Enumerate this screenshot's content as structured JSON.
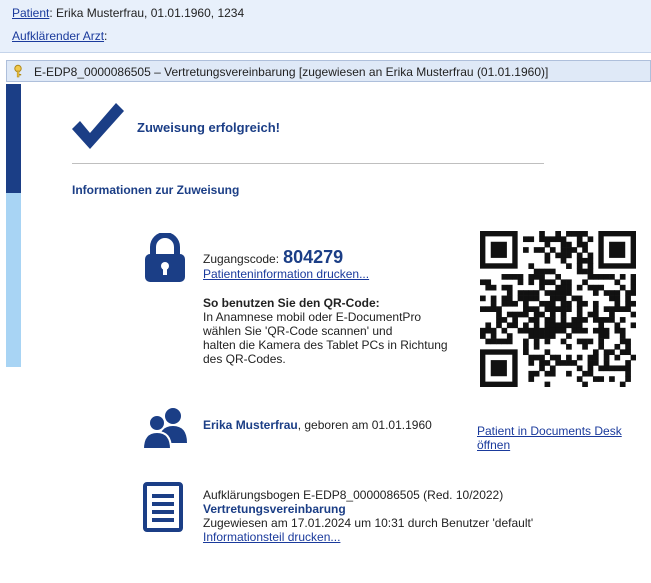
{
  "header": {
    "patient_label": "Patient",
    "patient_value": ": Erika Musterfrau, 01.01.1960, 1234",
    "doctor_label": "Aufklärender Arzt",
    "doctor_suffix": ":"
  },
  "document_bar": {
    "title": "E-EDP8_0000086505 – Vertretungsvereinbarung [zugewiesen an Erika Musterfrau (01.01.1960)]"
  },
  "main": {
    "success_message": "Zuweisung erfolgreich!",
    "info_heading": "Informationen zur Zuweisung",
    "access": {
      "label": "Zugangscode:",
      "code": "804279",
      "print_link": "Patienteninformation drucken..."
    },
    "qr_help": {
      "title": "So benutzen Sie den QR-Code:",
      "line1": "In Anamnese mobil oder E-DocumentPro",
      "line2": "wählen Sie 'QR-Code scannen' und",
      "line3": "halten die Kamera des Tablet PCs in Richtung",
      "line4": "des QR-Codes."
    },
    "patient": {
      "name": "Erika Musterfrau",
      "born": ", geboren am 01.01.1960",
      "documents_desk_link": "Patient in Documents Desk öffnen"
    },
    "form": {
      "id_line": "Aufklärungsbogen E-EDP8_0000086505 (Red. 10/2022)",
      "name": "Vertretungsvereinbarung",
      "assigned": "Zugewiesen am 17.01.2024 um 10:31 durch Benutzer 'default'",
      "print_link": "Informationsteil drucken..."
    }
  },
  "colors": {
    "brand_dark": "#1b3e86",
    "brand_light": "#a8d4f4",
    "link": "#1a3a9c"
  }
}
